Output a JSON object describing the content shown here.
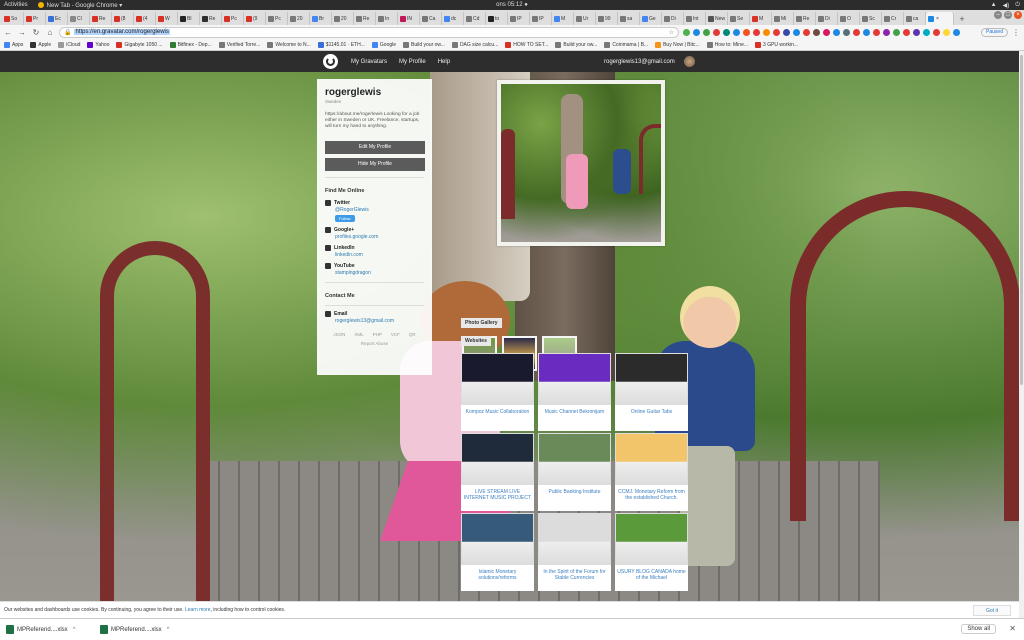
{
  "os_bar": {
    "activities": "Activities",
    "app": "New Tab - Google Chrome ▾",
    "clock": "ons 05:12 ●"
  },
  "tabs": [
    {
      "label": "So",
      "color": "#d93025"
    },
    {
      "label": "Pr",
      "color": "#d93025"
    },
    {
      "label": "Ec",
      "color": "#3a6fd8"
    },
    {
      "label": "Cl",
      "color": "#888888"
    },
    {
      "label": "Re",
      "color": "#d93025"
    },
    {
      "label": "(8",
      "color": "#d93025"
    },
    {
      "label": "(4",
      "color": "#d93025"
    },
    {
      "label": "W",
      "color": "#d93025"
    },
    {
      "label": "Bl",
      "color": "#222222"
    },
    {
      "label": "Re",
      "color": "#2c2c2c"
    },
    {
      "label": "Pc",
      "color": "#d93025"
    },
    {
      "label": "(9",
      "color": "#d93025"
    },
    {
      "label": "Pc",
      "color": "#777777"
    },
    {
      "label": "20",
      "color": "#777777"
    },
    {
      "label": "Br",
      "color": "#4285f4"
    },
    {
      "label": "20",
      "color": "#777777"
    },
    {
      "label": "Re",
      "color": "#777777"
    },
    {
      "label": "In",
      "color": "#777777"
    },
    {
      "label": "IN",
      "color": "#c2185b"
    },
    {
      "label": "Ca",
      "color": "#777777"
    },
    {
      "label": "dc",
      "color": "#4285f4"
    },
    {
      "label": "Cd",
      "color": "#777777"
    },
    {
      "label": "to",
      "color": "#222222"
    },
    {
      "label": "IP",
      "color": "#777777"
    },
    {
      "label": "IP",
      "color": "#777777"
    },
    {
      "label": "M",
      "color": "#4285f4"
    },
    {
      "label": "Ur",
      "color": "#777777"
    },
    {
      "label": "99",
      "color": "#777777"
    },
    {
      "label": "sa",
      "color": "#777777"
    },
    {
      "label": "Ge",
      "color": "#4285f4"
    },
    {
      "label": "Di",
      "color": "#777777"
    },
    {
      "label": "Int",
      "color": "#777777"
    },
    {
      "label": "New",
      "color": "#555555"
    },
    {
      "label": "Se",
      "color": "#777777"
    },
    {
      "label": "M",
      "color": "#d93025"
    },
    {
      "label": "Mi",
      "color": "#777777"
    },
    {
      "label": "Re",
      "color": "#777777"
    },
    {
      "label": "Di",
      "color": "#777777"
    },
    {
      "label": "O",
      "color": "#777777"
    },
    {
      "label": "Sc",
      "color": "#777777"
    },
    {
      "label": "Cr",
      "color": "#777777"
    },
    {
      "label": "ca",
      "color": "#777777"
    },
    {
      "label": "",
      "color": "#1e88e5",
      "active": true
    }
  ],
  "address": {
    "url": "https://en.gravatar.com/rogerglewis",
    "paused_label": "Paused"
  },
  "bookmarks": [
    {
      "label": "Apps",
      "color": "#4285f4"
    },
    {
      "label": "Apple",
      "color": "#333333"
    },
    {
      "label": "iCloud",
      "color": "#999999"
    },
    {
      "label": "Yahoo",
      "color": "#6001d2"
    },
    {
      "label": "Gigabyte 1050 ...",
      "color": "#d93025"
    },
    {
      "label": "Bitfinex - Dep...",
      "color": "#2e7d32"
    },
    {
      "label": "Verified Torre...",
      "color": "#777777"
    },
    {
      "label": "Welcome to N...",
      "color": "#777777"
    },
    {
      "label": "$1145.01 · ETH...",
      "color": "#3a6fd8"
    },
    {
      "label": "Google",
      "color": "#4285f4"
    },
    {
      "label": "Build your ow...",
      "color": "#777777"
    },
    {
      "label": "DAG size calcu...",
      "color": "#777777"
    },
    {
      "label": "HOW TO SET...",
      "color": "#d93025"
    },
    {
      "label": "Build your ow...",
      "color": "#777777"
    },
    {
      "label": "Coinmama | B...",
      "color": "#777777"
    },
    {
      "label": "Buy Now | Bitc...",
      "color": "#f7931a"
    },
    {
      "label": "How to: Mine...",
      "color": "#777777"
    },
    {
      "label": "3 GPU workin...",
      "color": "#d93025"
    }
  ],
  "gravatar": {
    "nav": [
      "My Gravatars",
      "My Profile",
      "Help"
    ],
    "email": "rogerglewis13@gmail.com"
  },
  "profile": {
    "username": "rogerglewis",
    "location": "Sweden",
    "about": "https://about.me/rogerlewis Looking for a job either in Sweden or UK. Freelance, startups, will turn my hand to anything.",
    "edit_button": "Edit My Profile",
    "hide_button": "Hide My Profile",
    "find_me_title": "Find Me Online",
    "accounts": [
      {
        "name": "Twitter",
        "link": "@RogerGlewis",
        "follow": "Follow"
      },
      {
        "name": "Google+",
        "link": "profiles.google.com"
      },
      {
        "name": "LinkedIn",
        "link": "linkedin.com"
      },
      {
        "name": "YouTube",
        "link": "stampingdragon"
      }
    ],
    "contact_title": "Contact Me",
    "email_label": "Email",
    "email_value": "rogerglewis13@gmail.com",
    "formats": [
      "JSON",
      "XML",
      "PHP",
      "VCF",
      "QR"
    ],
    "report": "Report Abuse"
  },
  "gallery_label": "Photo Gallery",
  "websites_label": "Websites",
  "websites": [
    {
      "caption": "Kompoz Music Collaboration",
      "color": "#1a1a2e"
    },
    {
      "caption": "Music Channel Bekronijam",
      "color": "#6a2cc0"
    },
    {
      "caption": "Online Guitar Tabs",
      "color": "#2b2b2b"
    },
    {
      "caption": "LIVE STREAM LIVE INTERNET MUSIC PROJECT",
      "color": "#1f2a3a"
    },
    {
      "caption": "Public Banking Institute",
      "color": "#6a8a5a"
    },
    {
      "caption": "CCMJ. Monetary Reform from the established Church.",
      "color": "#f3c56a"
    },
    {
      "caption": "Islamic Monetary solutions/reforms",
      "color": "#355a7a"
    },
    {
      "caption": "In the Spirit of the Forum for Stable Currencies",
      "color": "#dcdcdc"
    },
    {
      "caption": "USURY BLOG CANADA home of the Michael",
      "color": "#5a9a3a"
    }
  ],
  "cookie": {
    "text": "Our websites and dashboards use cookies. By continuing, you agree to their use.",
    "learn": "Learn more",
    "rest": ", including how to control cookies.",
    "button": "Got it"
  },
  "downloads": [
    {
      "name": "MPReferend....xlsx"
    },
    {
      "name": "MPReferend....xlsx"
    }
  ],
  "show_all": "Show all"
}
